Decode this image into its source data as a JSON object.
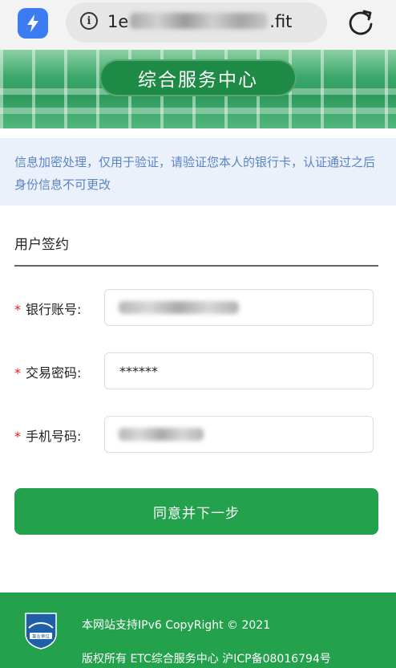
{
  "browser": {
    "url_prefix": "1e",
    "url_suffix": ".fit",
    "app_icon": "bolt-icon",
    "info_icon": "info-icon",
    "reload_icon": "reload-icon"
  },
  "banner": {
    "title": "综合服务中心"
  },
  "notice": {
    "text": "信息加密处理，仅用于验证，请验证您本人的银行卡，认证通过之后身份信息不可更改"
  },
  "form": {
    "section_title": "用户签约",
    "required_mark": "*",
    "fields": [
      {
        "label": "银行账号:",
        "value": ""
      },
      {
        "label": "交易密码:",
        "value": "******"
      },
      {
        "label": "手机号码:",
        "value": ""
      }
    ],
    "submit_label": "同意并下一步"
  },
  "footer": {
    "line1": "本网站支持IPv6 CopyRight © 2021",
    "line2": "版权所有 ETC综合服务中心 沪ICP备08016794号",
    "logo_text": "事业单位"
  },
  "colors": {
    "brand_green": "#23a14c",
    "notice_text": "#5c84c4",
    "notice_bg": "#eaf1fb",
    "required": "#dd2222"
  }
}
